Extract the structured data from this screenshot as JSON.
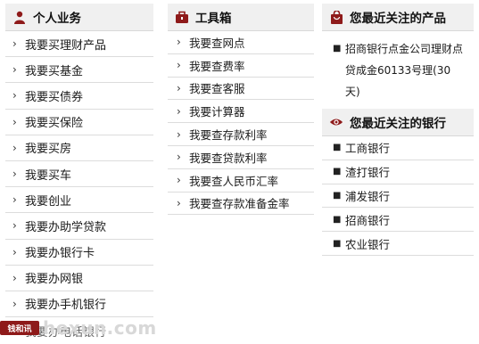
{
  "personal": {
    "title": "个人业务",
    "items": [
      "我要买理财产品",
      "我要买基金",
      "我要买债券",
      "我要买保险",
      "我要买房",
      "我要买车",
      "我要创业",
      "我要办助学贷款",
      "我要办银行卡",
      "我要办网银",
      "我要办手机银行",
      "我要办电话银行"
    ]
  },
  "tools": {
    "title": "工具箱",
    "items": [
      "我要查网点",
      "我要查费率",
      "我要查客服",
      "我要计算器",
      "我要查存款利率",
      "我要查贷款利率",
      "我要查人民币汇率",
      "我要查存款准备金率"
    ]
  },
  "recent_products": {
    "title": "您最近关注的产品",
    "items": [
      "招商银行点金公司理财点贷成金60133号理(30天)"
    ]
  },
  "recent_banks": {
    "title": "您最近关注的银行",
    "items": [
      "工商银行",
      "渣打银行",
      "浦发银行",
      "招商银行",
      "农业银行"
    ]
  },
  "watermark": {
    "badge": "钱和讯",
    "text": "hexun.com"
  },
  "colors": {
    "icon_red": "#8e1a1a",
    "header_bg": "#f0f0f0",
    "divider": "#dcdcdc"
  },
  "icons": {
    "personal": "person-icon",
    "tools": "toolbox-icon",
    "products": "shopping-bag-icon",
    "banks": "eye-icon",
    "row": "chevron-right-icon",
    "bullet": "bullet-icon"
  }
}
